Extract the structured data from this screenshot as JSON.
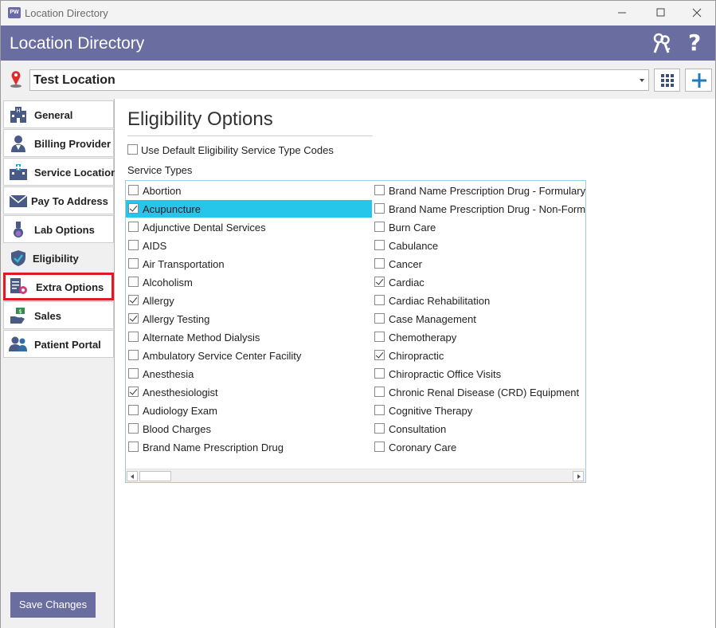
{
  "window": {
    "title": "Location Directory",
    "app_icon_text": "PW"
  },
  "header": {
    "title": "Location Directory",
    "help_label": "?",
    "accent_color": "#6a6da0"
  },
  "location": {
    "selected": "Test Location"
  },
  "sidebar": {
    "items": [
      {
        "label": "General",
        "icon": "hospital-building-icon"
      },
      {
        "label": "Billing Provider",
        "icon": "doctor-icon"
      },
      {
        "label": "Service Location",
        "icon": "clinic-building-icon"
      },
      {
        "label": "Pay To Address",
        "icon": "envelope-icon"
      },
      {
        "label": "Lab Options",
        "icon": "flask-icon"
      },
      {
        "label": "Eligibility",
        "icon": "shield-check-icon",
        "active": true
      },
      {
        "label": "Extra Options",
        "icon": "document-gear-icon",
        "highlighted": true
      },
      {
        "label": "Sales",
        "icon": "money-hand-icon"
      },
      {
        "label": "Patient Portal",
        "icon": "users-icon"
      }
    ],
    "save_label": "Save Changes"
  },
  "main": {
    "section_title": "Eligibility Options",
    "use_default_label": "Use Default Eligibility Service Type Codes",
    "use_default_checked": false,
    "service_types_label": "Service Types",
    "left_column": [
      {
        "label": "Abortion",
        "checked": false
      },
      {
        "label": "Acupuncture",
        "checked": true,
        "selected": true
      },
      {
        "label": "Adjunctive Dental Services",
        "checked": false
      },
      {
        "label": "AIDS",
        "checked": false
      },
      {
        "label": "Air Transportation",
        "checked": false
      },
      {
        "label": "Alcoholism",
        "checked": false
      },
      {
        "label": "Allergy",
        "checked": true
      },
      {
        "label": "Allergy Testing",
        "checked": true
      },
      {
        "label": "Alternate Method Dialysis",
        "checked": false
      },
      {
        "label": "Ambulatory Service Center Facility",
        "checked": false
      },
      {
        "label": "Anesthesia",
        "checked": false
      },
      {
        "label": "Anesthesiologist",
        "checked": true
      },
      {
        "label": "Audiology Exam",
        "checked": false
      },
      {
        "label": "Blood Charges",
        "checked": false
      },
      {
        "label": "Brand Name Prescription Drug",
        "checked": false
      }
    ],
    "right_column": [
      {
        "label": "Brand Name Prescription Drug - Formulary",
        "checked": false
      },
      {
        "label": "Brand Name Prescription Drug - Non-Formulary",
        "checked": false
      },
      {
        "label": "Burn Care",
        "checked": false
      },
      {
        "label": "Cabulance",
        "checked": false
      },
      {
        "label": "Cancer",
        "checked": false
      },
      {
        "label": "Cardiac",
        "checked": true
      },
      {
        "label": "Cardiac Rehabilitation",
        "checked": false
      },
      {
        "label": "Case Management",
        "checked": false
      },
      {
        "label": "Chemotherapy",
        "checked": false
      },
      {
        "label": "Chiropractic",
        "checked": true
      },
      {
        "label": "Chiropractic Office Visits",
        "checked": false
      },
      {
        "label": "Chronic Renal Disease (CRD) Equipment",
        "checked": false
      },
      {
        "label": "Cognitive Therapy",
        "checked": false
      },
      {
        "label": "Consultation",
        "checked": false
      },
      {
        "label": "Coronary Care",
        "checked": false
      }
    ]
  }
}
